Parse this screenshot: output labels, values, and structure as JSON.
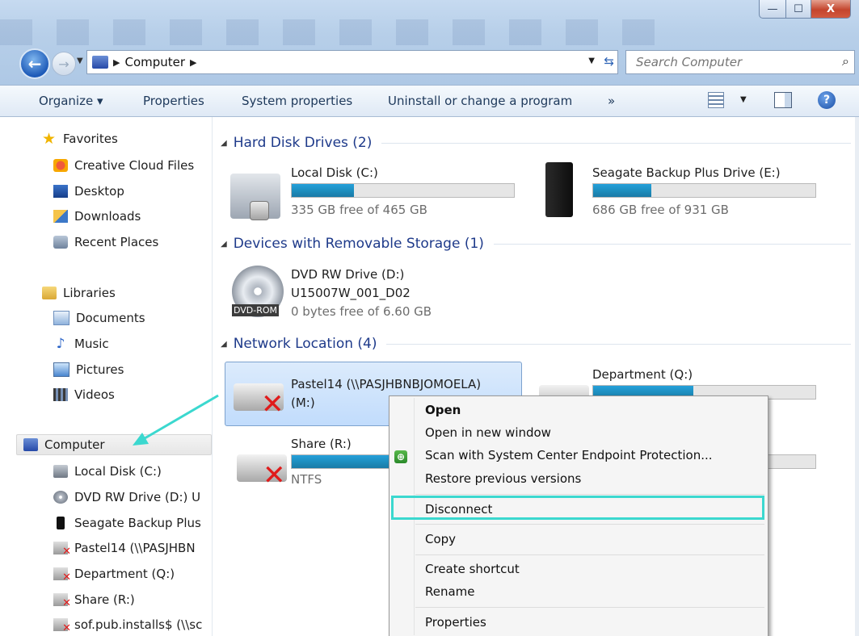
{
  "window": {
    "minimize_glyph": "—",
    "maximize_glyph": "☐",
    "close_glyph": "X"
  },
  "nav": {
    "back_glyph": "←",
    "forward_glyph": "→",
    "address_crumb": "Computer",
    "search_placeholder": "Search Computer"
  },
  "toolbar": {
    "organize": "Organize ▾",
    "properties": "Properties",
    "system_properties": "System properties",
    "uninstall": "Uninstall or change a program",
    "more": "»",
    "help_glyph": "?"
  },
  "sidebar": {
    "favorites": "Favorites",
    "favorites_items": [
      "Creative Cloud Files",
      "Desktop",
      "Downloads",
      "Recent Places"
    ],
    "libraries": "Libraries",
    "libraries_items": [
      "Documents",
      "Music",
      "Pictures",
      "Videos"
    ],
    "computer": "Computer",
    "computer_items": [
      "Local Disk (C:)",
      "DVD RW Drive (D:) U",
      "Seagate Backup Plus",
      "Pastel14 (\\\\PASJHBN",
      "Department (Q:)",
      "Share (R:)",
      "sof.pub.installs$ (\\\\sc"
    ]
  },
  "groups": {
    "hdd": "Hard Disk Drives (2)",
    "removable": "Devices with Removable Storage (1)",
    "network": "Network Location (4)"
  },
  "drives": {
    "c": {
      "name": "Local Disk (C:)",
      "free": "335 GB free of 465 GB",
      "used_fraction": 0.28
    },
    "e": {
      "name": "Seagate Backup Plus Drive (E:)",
      "free": "686 GB free of 931 GB",
      "used_fraction": 0.26
    },
    "d": {
      "name": "DVD RW Drive (D:)",
      "label": "U15007W_001_D02",
      "free": "0 bytes free of 6.60 GB",
      "badge": "DVD-ROM"
    },
    "m": {
      "name": "Pastel14 (\\\\PASJHBNBJOMOELA)",
      "name2": "(M:)"
    },
    "q": {
      "name": "Department (Q:)",
      "used_fraction": 0.45
    },
    "r": {
      "name": "Share (R:)",
      "sub": "NTFS",
      "used_fraction": 0.45
    }
  },
  "context_menu": {
    "items": [
      "Open",
      "Open in new window",
      "Scan with System Center Endpoint Protection...",
      "Restore previous versions",
      "Disconnect",
      "Copy",
      "Create shortcut",
      "Rename",
      "Properties"
    ]
  },
  "colors": {
    "accent": "#1e3a8a",
    "highlight": "#3bd8cf",
    "bar_fill": "#1e8fbf"
  }
}
